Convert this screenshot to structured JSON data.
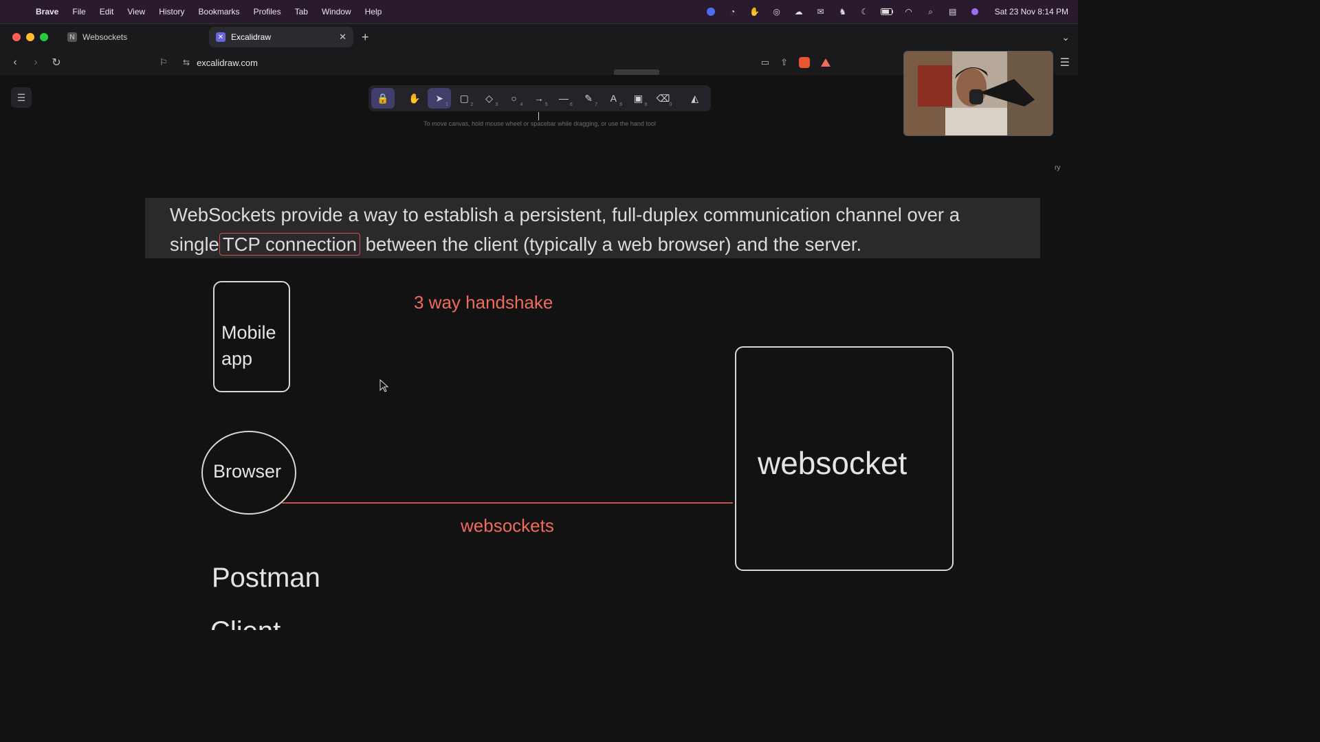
{
  "menubar": {
    "app": "Brave",
    "items": [
      "File",
      "Edit",
      "View",
      "History",
      "Bookmarks",
      "Profiles",
      "Tab",
      "Window",
      "Help"
    ],
    "clock": "Sat 23 Nov  8:14 PM"
  },
  "tabs": [
    {
      "label": "Websockets",
      "active": false
    },
    {
      "label": "Excalidraw",
      "active": true
    }
  ],
  "address": {
    "url": "excalidraw.com"
  },
  "canvas": {
    "hint": "To move canvas, hold mouse wheel or spacebar while dragging, or use the hand tool",
    "tools": [
      {
        "name": "lock-icon",
        "glyph": "🔒",
        "num": ""
      },
      {
        "name": "hand-icon",
        "glyph": "✋",
        "num": ""
      },
      {
        "name": "pointer-icon",
        "glyph": "➤",
        "num": "1"
      },
      {
        "name": "rectangle-icon",
        "glyph": "▢",
        "num": "2"
      },
      {
        "name": "diamond-icon",
        "glyph": "◇",
        "num": "3"
      },
      {
        "name": "ellipse-icon",
        "glyph": "○",
        "num": "4"
      },
      {
        "name": "arrow-icon",
        "glyph": "→",
        "num": "5"
      },
      {
        "name": "line-icon",
        "glyph": "—",
        "num": "6"
      },
      {
        "name": "pencil-icon",
        "glyph": "✎",
        "num": "7"
      },
      {
        "name": "text-icon",
        "glyph": "A",
        "num": "8"
      },
      {
        "name": "image-icon",
        "glyph": "▣",
        "num": "9"
      },
      {
        "name": "eraser-icon",
        "glyph": "⌫",
        "num": "0"
      },
      {
        "name": "extra-tools-icon",
        "glyph": "◭",
        "num": ""
      }
    ],
    "text_before": "WebSockets provide a way to establish a persistent, full-duplex communication channel over a single",
    "text_highlight": "TCP connection",
    "text_after": " between the client (typically a web browser) and the server.",
    "mobile_app": "Mobile app",
    "handshake": "3 way handshake",
    "browser": "Browser",
    "websocket": "websocket",
    "websockets_label": "websockets",
    "postman": "Postman",
    "cut_text": "Client"
  }
}
